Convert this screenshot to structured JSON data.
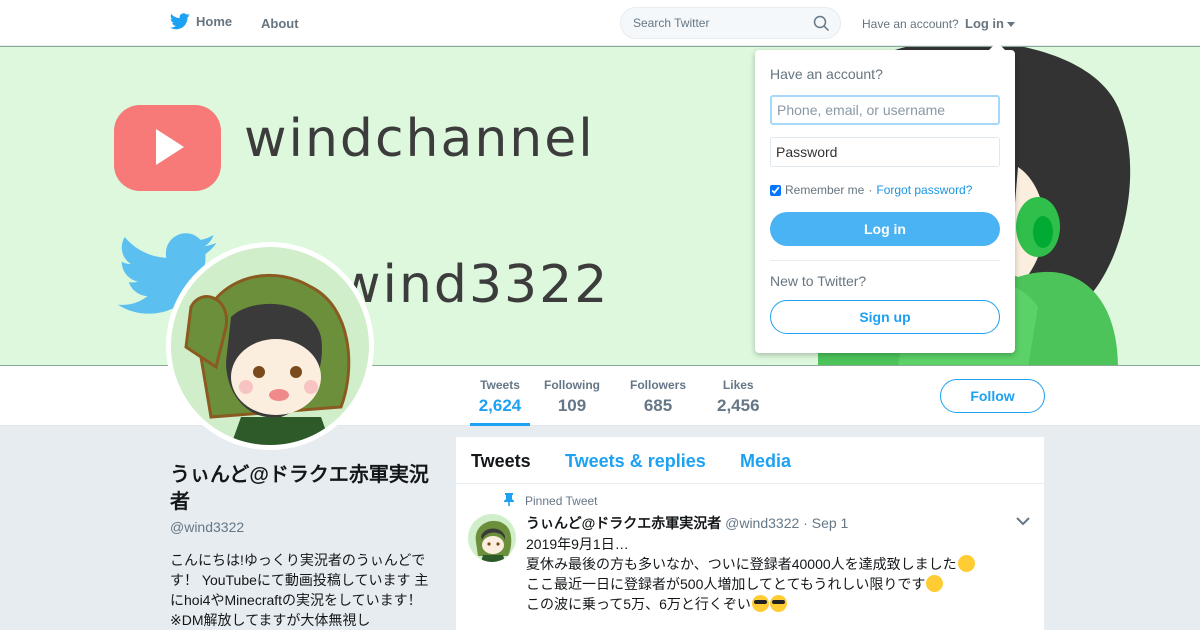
{
  "nav": {
    "home_label": "Home",
    "about_label": "About",
    "search_placeholder": "Search Twitter",
    "have_account": "Have an account?",
    "login_label": "Log in"
  },
  "banner": {
    "channel_text": "windchannel",
    "handle_text": "wind3322"
  },
  "stats": [
    {
      "label": "Tweets",
      "value": "2,624"
    },
    {
      "label": "Following",
      "value": "109"
    },
    {
      "label": "Followers",
      "value": "685"
    },
    {
      "label": "Likes",
      "value": "2,456"
    }
  ],
  "follow_label": "Follow",
  "profile": {
    "name": "うぃんど@ドラクエ赤軍実況者",
    "handle": "@wind3322",
    "bio": "こんにちは!ゆっくり実況者のうぃんどです！ YouTubeにて動画投稿しています 主にhoi4やMinecraftの実況をしています！　※DM解放してますが大体無視し"
  },
  "timeline": {
    "tabs": [
      "Tweets",
      "Tweets & replies",
      "Media"
    ],
    "pinned_label": "Pinned Tweet",
    "tweet": {
      "name": "うぃんど@ドラクエ赤軍実況者",
      "handle": "@wind3322",
      "separator": "·",
      "date": "Sep 1",
      "lines": [
        "2019年9月1日…",
        "夏休み最後の方も多いなか、ついに登録者40000人を達成致しました",
        "ここ最近一日に登録者が500人増加してとてもうれしい限りです",
        "この波に乗って5万、6万と行くぞい"
      ]
    }
  },
  "login_dropdown": {
    "heading": "Have an account?",
    "username_placeholder": "Phone, email, or username",
    "password_placeholder": "Password",
    "remember_label": "Remember me",
    "separator": "·",
    "forgot_label": "Forgot password?",
    "login_button": "Log in",
    "new_label": "New to Twitter?",
    "signup_button": "Sign up"
  },
  "colors": {
    "accent": "#1da1f2",
    "login_button": "#4ab3f4",
    "banner_bg": "#ddf8dd"
  }
}
